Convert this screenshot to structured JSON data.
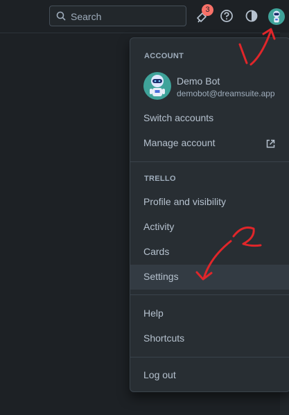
{
  "header": {
    "search_placeholder": "Search",
    "notification_count": "3",
    "icons": [
      "search-icon",
      "megaphone-icon",
      "help-icon",
      "theme-icon",
      "avatar"
    ]
  },
  "menu": {
    "account_section": "ACCOUNT",
    "user_name": "Demo Bot",
    "user_email": "demobot@dreamsuite.app",
    "switch_accounts": "Switch accounts",
    "manage_account": "Manage account",
    "trello_section": "TRELLO",
    "profile_visibility": "Profile and visibility",
    "activity": "Activity",
    "cards": "Cards",
    "settings": "Settings",
    "help": "Help",
    "shortcuts": "Shortcuts",
    "log_out": "Log out"
  },
  "colors": {
    "background": "#1d2125",
    "menu": "#282e33",
    "accent_annotation": "#e0262a",
    "badge": "#f87168"
  }
}
